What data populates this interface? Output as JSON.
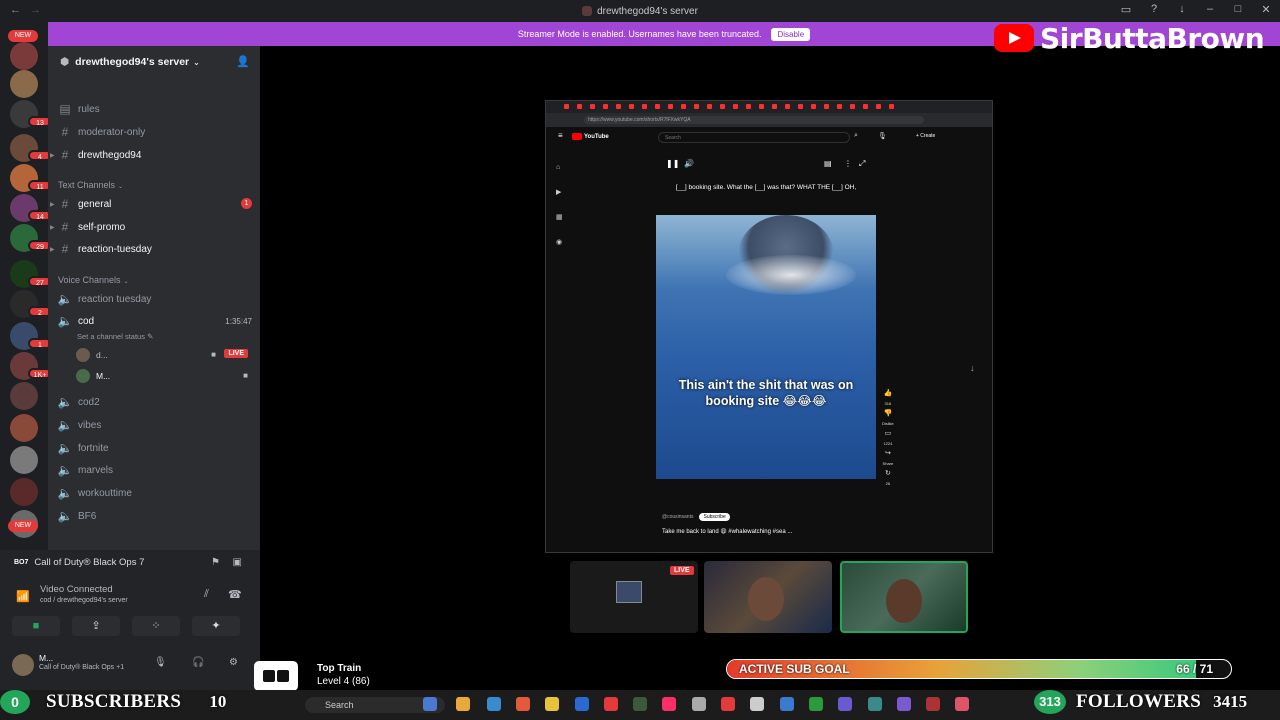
{
  "window": {
    "title": "drewthegod94's server"
  },
  "banner": {
    "text": "Streamer Mode is enabled. Usernames have been truncated.",
    "button": "Disable"
  },
  "rail": {
    "badges": [
      "NEW",
      "13",
      "4",
      "11",
      "14",
      "29",
      "27",
      "2",
      "1",
      "1K+",
      "NEW"
    ]
  },
  "server": {
    "name": "drewthegod94's server"
  },
  "channels": {
    "top": [
      "rules",
      "moderator-only",
      "drewthegod94"
    ],
    "text_category": "Text Channels",
    "text": [
      {
        "name": "general",
        "badge": "1"
      },
      {
        "name": "self-promo",
        "badge": ""
      },
      {
        "name": "reaction-tuesday",
        "badge": ""
      }
    ],
    "voice_category": "Voice Channels",
    "voice": [
      "reaction tuesday",
      "cod",
      "cod2",
      "vibes",
      "fortnite",
      "marvels",
      "workouttime",
      "BF6"
    ],
    "cod_time": "1:35:47",
    "cod_status": "Set a channel status",
    "voice_users": [
      {
        "name": "d...",
        "live": "LIVE"
      },
      {
        "name": "M...",
        "live": ""
      }
    ]
  },
  "activity": {
    "tag": "BO7",
    "game": "Call of Duty® Black Ops 7"
  },
  "voice_connection": {
    "title": "Video Connected",
    "subtitle": "cod / drewthegod94's server"
  },
  "user": {
    "name": "M...",
    "game": "Call of Duty® Black Ops +1"
  },
  "player": {
    "url": "https://www.youtube.com/shorts/R7lFXwkYQA",
    "brand": "YouTube",
    "search": "Search",
    "top_caption": "[__] booking site. What the [__] was that? WHAT THE [__] OH,",
    "caption": "This ain't the shit that was on booking site 😂😂😂",
    "channel": "@cousinsants",
    "subscribe": "Subscribe",
    "description": "Take me back to land 😩 #whalewatching #sea ...",
    "actions": [
      "316",
      "Dislike",
      "1224",
      "Share",
      "26"
    ],
    "sidebar": [
      "Home",
      "Shorts",
      "Subscriptions",
      "You"
    ]
  },
  "tiles": {
    "live": "LIVE"
  },
  "overlay": {
    "channel_name": "SirButtaBrown",
    "sub_goal": {
      "label": "ACTIVE SUB GOAL",
      "current": 66,
      "target": 71,
      "text": "66 / 71"
    },
    "top_train": {
      "title": "Top Train",
      "level": "Level 4 (86)"
    },
    "subscribers": {
      "count_badge": "0",
      "label": "SUBSCRIBERS",
      "value": "10"
    },
    "followers": {
      "count_badge": "313",
      "label": "FOLLOWERS",
      "value": "3415"
    }
  },
  "taskbar": {
    "search": "Search"
  },
  "colors": {
    "accent": "#a145d4",
    "live": "#e33b3b",
    "green": "#23a55a",
    "youtube": "#ff0000"
  }
}
